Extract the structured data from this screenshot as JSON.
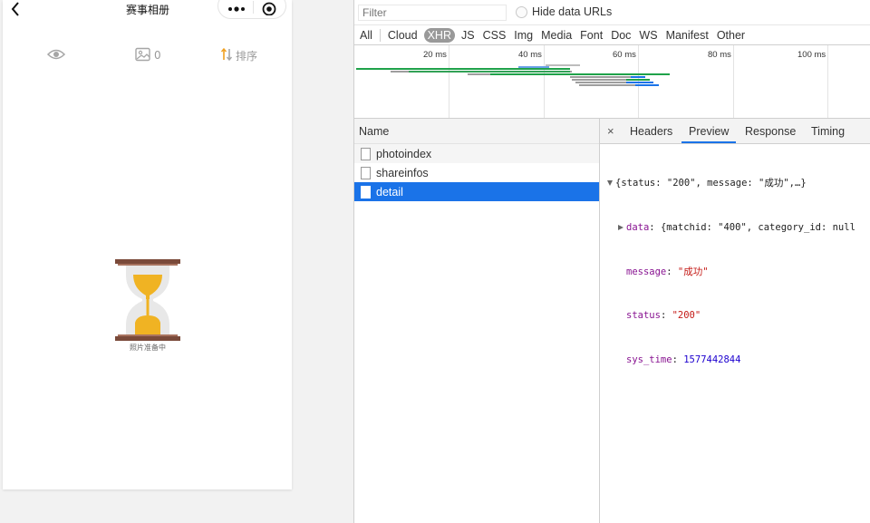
{
  "phone": {
    "title": "赛事相册",
    "photo_count": "0",
    "sort_label": "排序",
    "loading_text": "照片准备中",
    "colors": {
      "hourglass_frame": "#7a4a3a",
      "sand": "#f0b323",
      "glass": "#e8e8e8"
    },
    "icons": [
      "back-arrow-icon",
      "more-dots-icon",
      "close-circle-icon",
      "eye-icon",
      "image-icon",
      "sort-icon",
      "hourglass-icon"
    ]
  },
  "devtools": {
    "filter_placeholder": "Filter",
    "hide_data_urls_label": "Hide data URLs",
    "type_filters": [
      "All",
      "Cloud",
      "XHR",
      "JS",
      "CSS",
      "Img",
      "Media",
      "Font",
      "Doc",
      "WS",
      "Manifest",
      "Other"
    ],
    "active_type": "XHR",
    "timeline_ticks": [
      "20 ms",
      "40 ms",
      "60 ms",
      "80 ms",
      "100 ms"
    ],
    "column_name": "Name",
    "requests": [
      "photoindex",
      "shareinfos",
      "detail"
    ],
    "selected_request": "detail",
    "detail_tabs": [
      "Headers",
      "Preview",
      "Response",
      "Timing"
    ],
    "active_detail_tab": "Preview",
    "close_label": "×",
    "preview": {
      "summary": "{status: \"200\", message: \"成功\",…}",
      "data_key": "data",
      "data_value": "{matchid: \"400\", category_id: null",
      "message_key": "message",
      "message_value": "\"成功\"",
      "status_key": "status",
      "status_value": "\"200\"",
      "sys_time_key": "sys_time",
      "sys_time_value": "1577442844"
    },
    "colors": {
      "selected_row": "#1a73e8",
      "active_tab_underline": "#1a73e8",
      "waterfall_green": "#1fa24a",
      "waterfall_blue": "#1a73e8",
      "waterfall_gray": "#9e9e9e"
    }
  }
}
